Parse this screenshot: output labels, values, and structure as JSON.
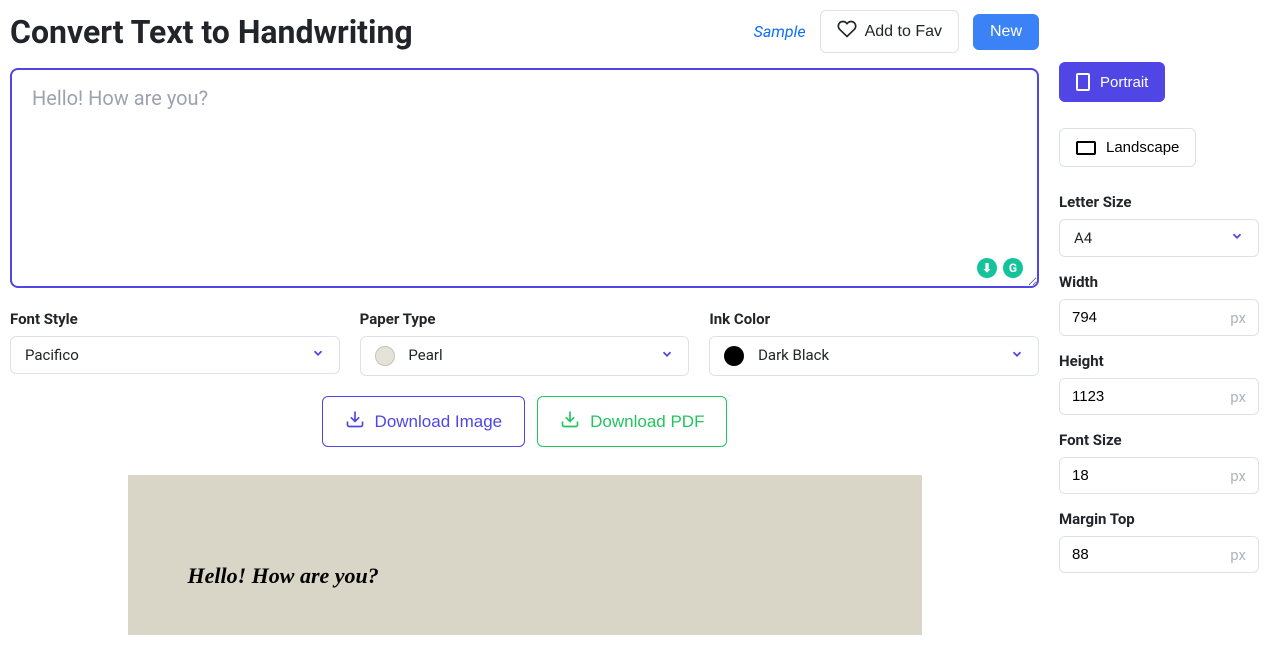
{
  "header": {
    "title": "Convert Text to Handwriting",
    "sample": "Sample",
    "add_to_fav": "Add to Fav",
    "new_btn": "New"
  },
  "input": {
    "placeholder": "Hello! How are you?",
    "value": ""
  },
  "controls": {
    "font_style": {
      "label": "Font Style",
      "value": "Pacifico"
    },
    "paper_type": {
      "label": "Paper Type",
      "value": "Pearl"
    },
    "ink_color": {
      "label": "Ink Color",
      "value": "Dark Black"
    }
  },
  "download": {
    "image": "Download Image",
    "pdf": "Download PDF"
  },
  "preview": {
    "text": "Hello! How are you?"
  },
  "sidebar": {
    "portrait": "Portrait",
    "landscape": "Landscape",
    "letter_size": {
      "label": "Letter Size",
      "value": "A4"
    },
    "width": {
      "label": "Width",
      "value": "794",
      "unit": "px"
    },
    "height": {
      "label": "Height",
      "value": "1123",
      "unit": "px"
    },
    "font_size": {
      "label": "Font Size",
      "value": "18",
      "unit": "px"
    },
    "margin_top": {
      "label": "Margin Top",
      "value": "88",
      "unit": "px"
    }
  }
}
